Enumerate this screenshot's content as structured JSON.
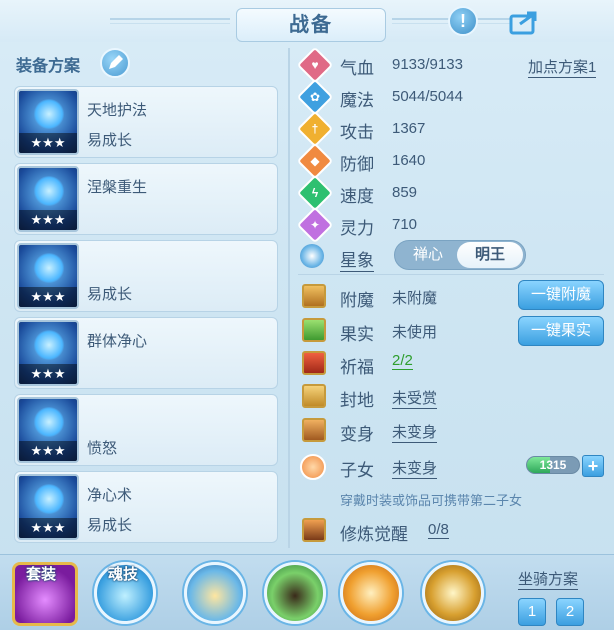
{
  "title": "战备",
  "colors": {
    "accent": "#3b9fe0",
    "green": "#2e9e2e"
  },
  "left": {
    "header": "装备方案",
    "schemes": [
      {
        "name1": "天地护法",
        "name2": "易成长",
        "stars": "★★★",
        "color": "#1e5ab0"
      },
      {
        "name1": "涅槃重生",
        "name2": "",
        "stars": "★★★",
        "color": "#1a4fa6"
      },
      {
        "name1": "",
        "name2": "易成长",
        "stars": "★★★",
        "color": "#1f5fb8"
      },
      {
        "name1": "群体净心",
        "name2": "",
        "stars": "★★★",
        "color": "#1b59b0"
      },
      {
        "name1": "",
        "name2": "愤怒",
        "stars": "★★★",
        "color": "#1e4f9c"
      },
      {
        "name1": "净心术",
        "name2": "易成长",
        "stars": "★★★",
        "color": "#1d5bb3"
      }
    ]
  },
  "stats": {
    "plan_link": "加点方案1",
    "items": [
      {
        "label": "气血",
        "value": "9133/9133",
        "icon": "heart-icon",
        "color": "#e06a86"
      },
      {
        "label": "魔法",
        "value": "5044/5044",
        "icon": "magic-icon",
        "color": "#3fa0e0"
      },
      {
        "label": "攻击",
        "value": "1367",
        "icon": "sword-icon",
        "color": "#f0b030"
      },
      {
        "label": "防御",
        "value": "1640",
        "icon": "shield-icon",
        "color": "#f08a40"
      },
      {
        "label": "速度",
        "value": "859",
        "icon": "speed-icon",
        "color": "#2ec070"
      },
      {
        "label": "灵力",
        "value": "710",
        "icon": "spirit-icon",
        "color": "#c070e0"
      }
    ],
    "star_label": "星象",
    "toggle_a": "禅心",
    "toggle_b": "明王"
  },
  "extras": {
    "enchant_label": "附魔",
    "enchant_value": "未附魔",
    "enchant_button": "一键附魔",
    "fruit_label": "果实",
    "fruit_value": "未使用",
    "fruit_button": "一键果实",
    "bless_label": "祈福",
    "bless_value": "2/2",
    "seal_label": "封地",
    "seal_value": "未受赏",
    "transform_label": "变身",
    "transform_value": "未变身",
    "child_label": "子女",
    "child_value": "未变身",
    "xp_value": "1315",
    "xp_fill": 0.45,
    "hint": "穿戴时装或饰品可携带第二子女",
    "cultivate_label": "修炼觉醒",
    "cultivate_value": "0/8"
  },
  "bottom": {
    "suit_label": "套装",
    "soul_label": "魂技",
    "mount_label": "坐骑方案",
    "mount_1": "1",
    "mount_2": "2"
  }
}
